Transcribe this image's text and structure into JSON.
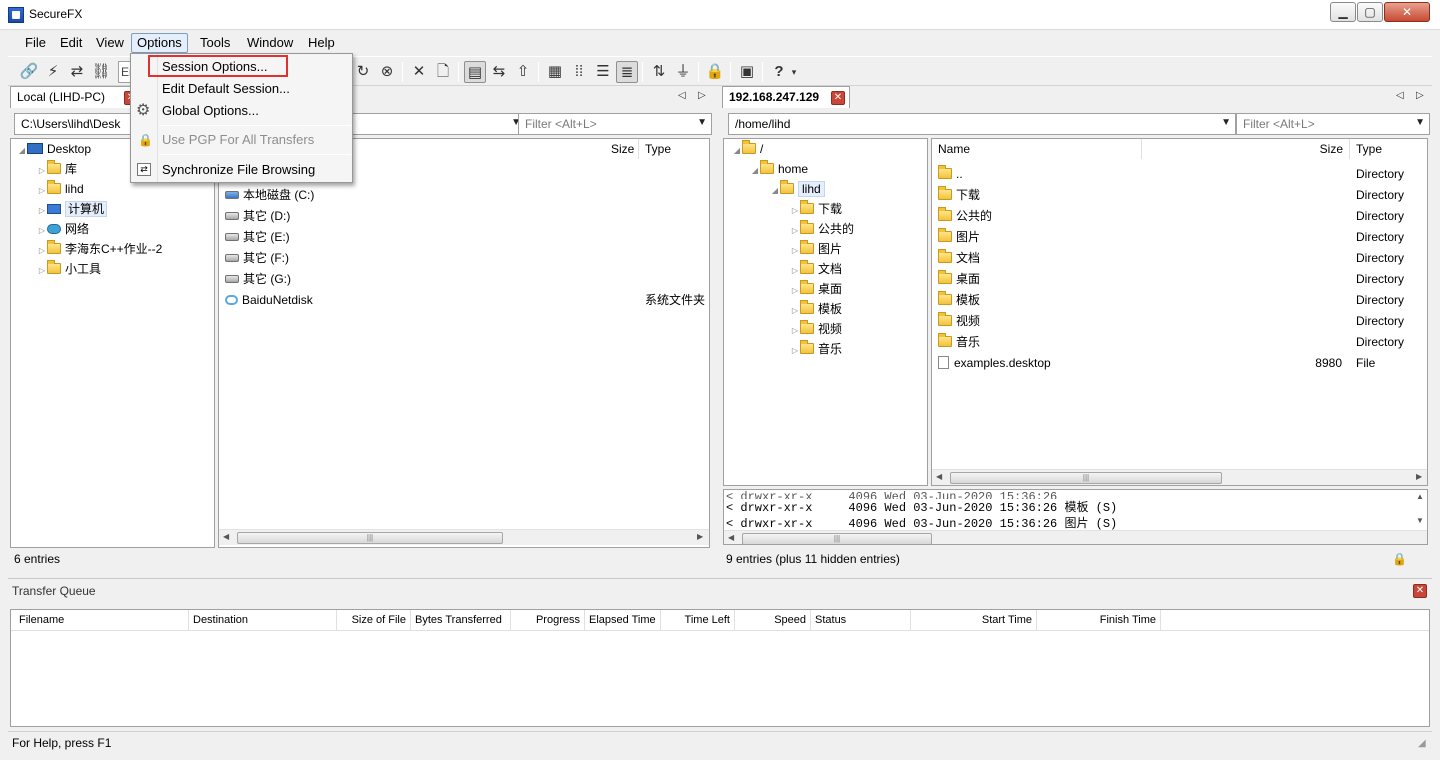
{
  "window": {
    "title": "SecureFX",
    "minimize": "▁",
    "maximize": "▢",
    "close": "✕"
  },
  "menubar": [
    "File",
    "Edit",
    "View",
    "Options",
    "Tools",
    "Window",
    "Help"
  ],
  "toolbar": {
    "input_fragment": "Er"
  },
  "options_menu": {
    "items": [
      {
        "label": "Session Options...",
        "enabled": true
      },
      {
        "label": "Edit Default Session...",
        "enabled": true
      },
      {
        "label": "Global Options...",
        "enabled": true
      },
      {
        "label": "Use PGP For All Transfers",
        "enabled": false
      },
      {
        "label": "Synchronize File Browsing",
        "enabled": true
      }
    ]
  },
  "local": {
    "tab": "Local (LIHD-PC)",
    "path": "C:\\Users\\lihd\\Desk",
    "filter_placeholder": "Filter <Alt+L>",
    "tree": [
      {
        "label": "Desktop",
        "level": 0
      },
      {
        "label": "库",
        "level": 1
      },
      {
        "label": "lihd",
        "level": 1
      },
      {
        "label": "计算机",
        "level": 1
      },
      {
        "label": "网络",
        "level": 1
      },
      {
        "label": "李海东C++作业--2",
        "level": 1
      },
      {
        "label": "小工具",
        "level": 1
      }
    ],
    "columns": {
      "size": "Size",
      "type": "Type"
    },
    "files": [
      {
        "name": "本地磁盘 (C:)",
        "type": ""
      },
      {
        "name": "其它 (D:)",
        "type": ""
      },
      {
        "name": "其它 (E:)",
        "type": ""
      },
      {
        "name": "其它 (F:)",
        "type": ""
      },
      {
        "name": "其它 (G:)",
        "type": ""
      },
      {
        "name": "BaiduNetdisk",
        "type": "系统文件夹"
      }
    ],
    "status": "6 entries"
  },
  "remote": {
    "tab": "192.168.247.129",
    "path": "/home/lihd",
    "filter_placeholder": "Filter <Alt+L>",
    "tree": [
      {
        "label": "/",
        "level": 0
      },
      {
        "label": "home",
        "level": 1
      },
      {
        "label": "lihd",
        "level": 2
      },
      {
        "label": "下载",
        "level": 3
      },
      {
        "label": "公共的",
        "level": 3
      },
      {
        "label": "图片",
        "level": 3
      },
      {
        "label": "文档",
        "level": 3
      },
      {
        "label": "桌面",
        "level": 3
      },
      {
        "label": "模板",
        "level": 3
      },
      {
        "label": "视频",
        "level": 3
      },
      {
        "label": "音乐",
        "level": 3
      }
    ],
    "columns": {
      "name": "Name",
      "size": "Size",
      "type": "Type"
    },
    "files": [
      {
        "name": "..",
        "size": "",
        "type": "Directory"
      },
      {
        "name": "下载",
        "size": "",
        "type": "Directory"
      },
      {
        "name": "公共的",
        "size": "",
        "type": "Directory"
      },
      {
        "name": "图片",
        "size": "",
        "type": "Directory"
      },
      {
        "name": "文档",
        "size": "",
        "type": "Directory"
      },
      {
        "name": "桌面",
        "size": "",
        "type": "Directory"
      },
      {
        "name": "模板",
        "size": "",
        "type": "Directory"
      },
      {
        "name": "视频",
        "size": "",
        "type": "Directory"
      },
      {
        "name": "音乐",
        "size": "",
        "type": "Directory"
      },
      {
        "name": "examples.desktop",
        "size": "8980",
        "type": "File"
      }
    ],
    "log": [
      "< drwxr-xr-x     4096 Wed 03-Jun-2020 15:36:26 模板 (S)",
      "< drwxr-xr-x     4096 Wed 03-Jun-2020 15:36:26 图片 (S)"
    ],
    "status": "9 entries (plus 11 hidden entries)"
  },
  "transfer_queue": {
    "title": "Transfer Queue",
    "columns": [
      "Filename",
      "Destination",
      "Size of File",
      "Bytes Transferred",
      "Progress",
      "Elapsed Time",
      "Time Left",
      "Speed",
      "Status",
      "Start Time",
      "Finish Time"
    ]
  },
  "statusbar": "For Help, press F1"
}
